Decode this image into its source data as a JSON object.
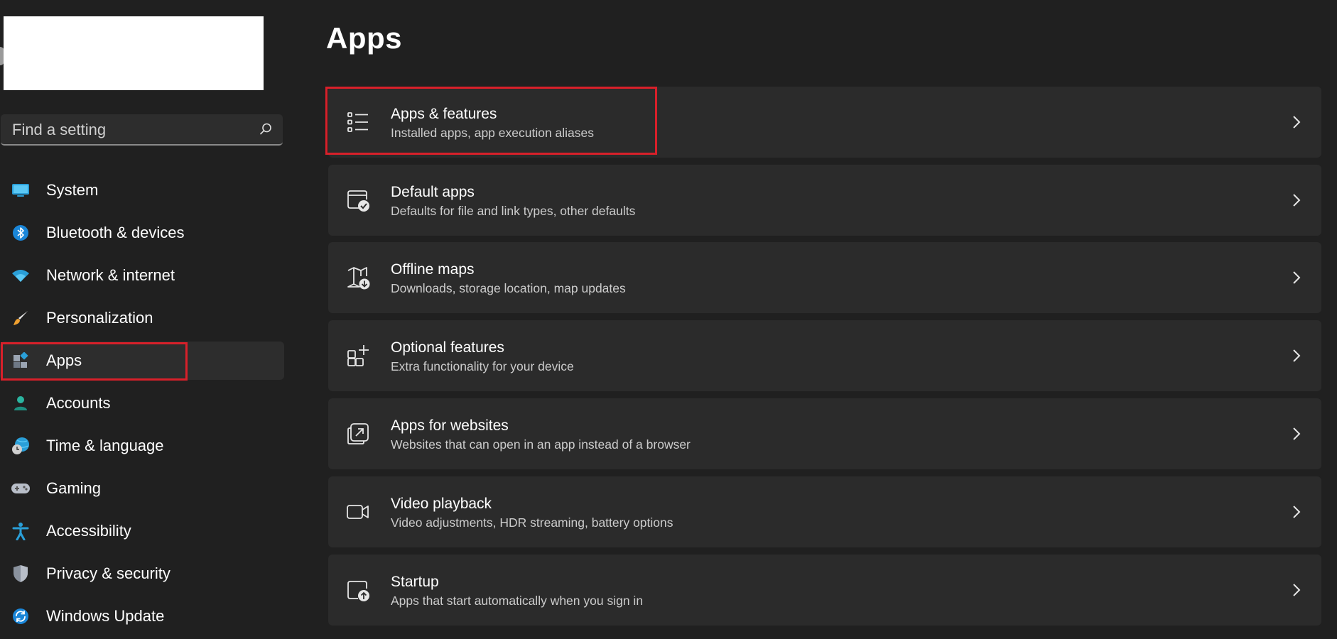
{
  "search": {
    "placeholder": "Find a setting"
  },
  "sidebar": {
    "items": [
      {
        "label": "System",
        "icon": "monitor-icon"
      },
      {
        "label": "Bluetooth & devices",
        "icon": "bluetooth-icon"
      },
      {
        "label": "Network & internet",
        "icon": "wifi-icon"
      },
      {
        "label": "Personalization",
        "icon": "brush-icon"
      },
      {
        "label": "Apps",
        "icon": "apps-icon",
        "selected": true
      },
      {
        "label": "Accounts",
        "icon": "person-icon"
      },
      {
        "label": "Time & language",
        "icon": "globe-clock-icon"
      },
      {
        "label": "Gaming",
        "icon": "gamepad-icon"
      },
      {
        "label": "Accessibility",
        "icon": "accessibility-icon"
      },
      {
        "label": "Privacy & security",
        "icon": "shield-icon"
      },
      {
        "label": "Windows Update",
        "icon": "update-icon"
      }
    ]
  },
  "main": {
    "title": "Apps",
    "cards": [
      {
        "title": "Apps & features",
        "subtitle": "Installed apps, app execution aliases",
        "icon": "list-icon"
      },
      {
        "title": "Default apps",
        "subtitle": "Defaults for file and link types, other defaults",
        "icon": "default-apps-icon"
      },
      {
        "title": "Offline maps",
        "subtitle": "Downloads, storage location, map updates",
        "icon": "map-download-icon"
      },
      {
        "title": "Optional features",
        "subtitle": "Extra functionality for your device",
        "icon": "add-grid-icon"
      },
      {
        "title": "Apps for websites",
        "subtitle": "Websites that can open in an app instead of a browser",
        "icon": "open-external-icon"
      },
      {
        "title": "Video playback",
        "subtitle": "Video adjustments, HDR streaming, battery options",
        "icon": "video-camera-icon"
      },
      {
        "title": "Startup",
        "subtitle": "Apps that start automatically when you sign in",
        "icon": "startup-icon"
      }
    ]
  },
  "colors": {
    "background": "#202020",
    "card": "#2b2b2b",
    "selected_nav": "#2d2d2d",
    "highlight_border": "#d8202a",
    "accent": "#4cc2ff"
  }
}
